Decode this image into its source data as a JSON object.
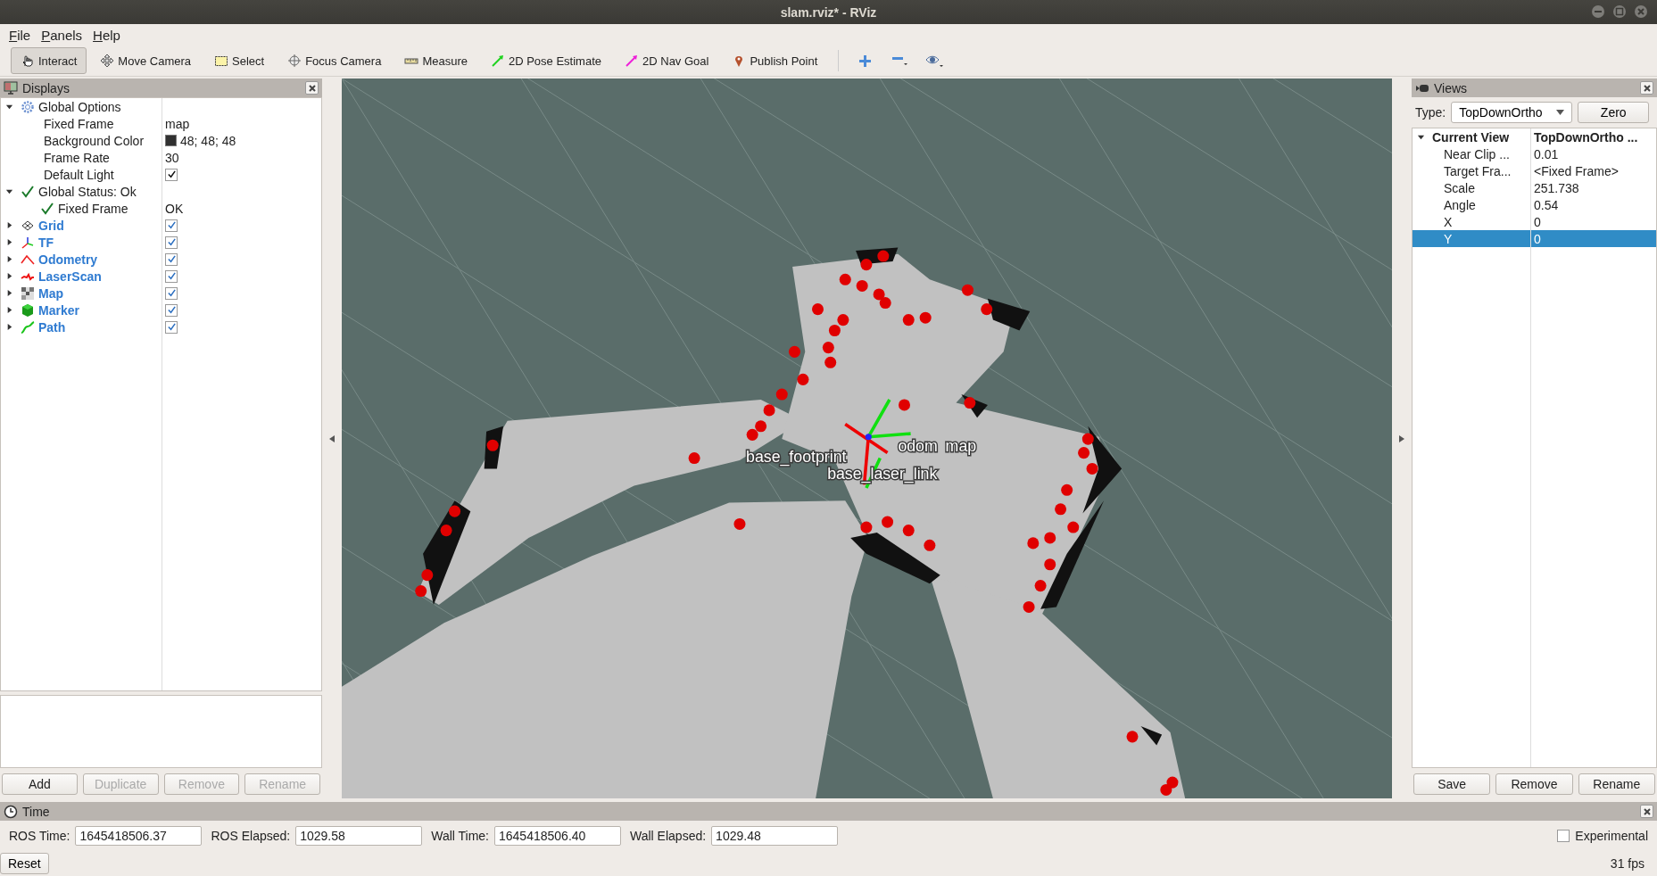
{
  "window": {
    "title": "slam.rviz* - RViz"
  },
  "menu": [
    "File",
    "Panels",
    "Help"
  ],
  "toolbar": [
    {
      "label": "Interact",
      "kind": "hand",
      "selected": true
    },
    {
      "label": "Move Camera",
      "kind": "move",
      "selected": false
    },
    {
      "label": "Select",
      "kind": "select",
      "selected": false
    },
    {
      "label": "Focus Camera",
      "kind": "focus",
      "selected": false
    },
    {
      "label": "Measure",
      "kind": "measure",
      "selected": false
    },
    {
      "label": "2D Pose Estimate",
      "kind": "pose",
      "selected": false
    },
    {
      "label": "2D Nav Goal",
      "kind": "goal",
      "selected": false
    },
    {
      "label": "Publish Point",
      "kind": "point",
      "selected": false
    }
  ],
  "displays": {
    "title": "Displays",
    "tree": [
      {
        "label": "Global Options",
        "kind": "options",
        "expanded": true,
        "children": [
          {
            "label": "Fixed Frame",
            "value": "map"
          },
          {
            "label": "Background Color",
            "value": "48; 48; 48",
            "color": "#303030"
          },
          {
            "label": "Frame Rate",
            "value": "30"
          },
          {
            "label": "Default Light",
            "checked": true
          }
        ]
      },
      {
        "label": "Global Status: Ok",
        "kind": "status",
        "expanded": true,
        "children": [
          {
            "label": "Fixed Frame",
            "value": "OK",
            "kind": "status"
          }
        ]
      },
      {
        "label": "Grid",
        "kind": "grid",
        "expanded": false,
        "checked": true
      },
      {
        "label": "TF",
        "kind": "tf",
        "expanded": false,
        "checked": true
      },
      {
        "label": "Odometry",
        "kind": "odometry",
        "expanded": false,
        "checked": true
      },
      {
        "label": "LaserScan",
        "kind": "laserscan",
        "expanded": false,
        "checked": true
      },
      {
        "label": "Map",
        "kind": "map",
        "expanded": false,
        "checked": true
      },
      {
        "label": "Marker",
        "kind": "marker",
        "expanded": false,
        "checked": true
      },
      {
        "label": "Path",
        "kind": "path",
        "expanded": false,
        "checked": true
      }
    ],
    "buttons": [
      {
        "label": "Add",
        "disabled": false
      },
      {
        "label": "Duplicate",
        "disabled": true
      },
      {
        "label": "Remove",
        "disabled": true
      },
      {
        "label": "Rename",
        "disabled": true
      }
    ]
  },
  "viewport": {
    "frame_labels": [
      "base_footprint",
      "odom",
      "map",
      "base_laser_link"
    ]
  },
  "views": {
    "title": "Views",
    "type_label": "Type:",
    "type_value": "TopDownOrtho",
    "zero": "Zero",
    "current": {
      "label": "Current View",
      "value": "TopDownOrtho ...",
      "expanded": true
    },
    "props": [
      {
        "label": "Near Clip ...",
        "value": "0.01",
        "selected": false
      },
      {
        "label": "Target Fra...",
        "value": "<Fixed Frame>",
        "selected": false
      },
      {
        "label": "Scale",
        "value": "251.738",
        "selected": false
      },
      {
        "label": "Angle",
        "value": "0.54",
        "selected": false
      },
      {
        "label": "X",
        "value": "0",
        "selected": false
      },
      {
        "label": "Y",
        "value": "0",
        "selected": true
      }
    ],
    "buttons": [
      "Save",
      "Remove",
      "Rename"
    ]
  },
  "time": {
    "title": "Time",
    "fields": [
      {
        "label": "ROS Time:",
        "value": "1645418506.37"
      },
      {
        "label": "ROS Elapsed:",
        "value": "1029.58"
      },
      {
        "label": "Wall Time:",
        "value": "1645418506.40"
      },
      {
        "label": "Wall Elapsed:",
        "value": "1029.48"
      }
    ],
    "experimental": {
      "label": "Experimental",
      "checked": false
    },
    "reset": "Reset",
    "fps": "31 fps"
  }
}
